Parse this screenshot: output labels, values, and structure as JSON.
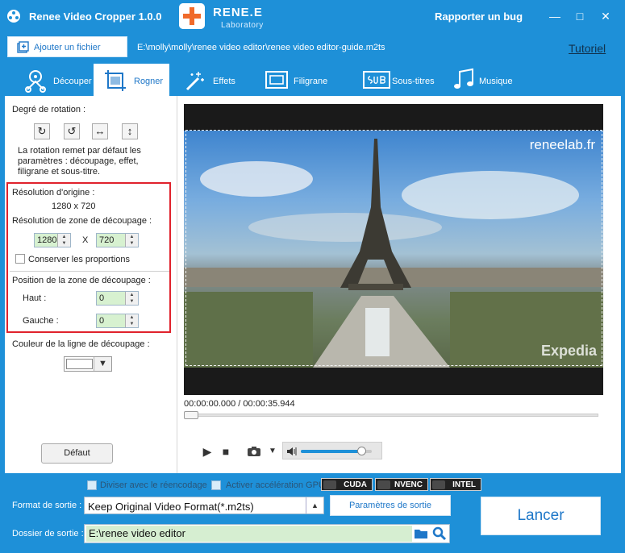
{
  "titlebar": {
    "app_title": "Renee Video Cropper 1.0.0",
    "brand_name": "RENE.E",
    "brand_sub": "Laboratory",
    "bug_link": "Rapporter un bug",
    "minimize": "—",
    "maximize": "□",
    "close": "✕"
  },
  "toolbar": {
    "add_file": "Ajouter un fichier",
    "file_path": "E:\\molly\\molly\\renee video editor\\renee video editor-guide.m2ts",
    "tutoriel": "Tutoriel"
  },
  "tabs": [
    {
      "label": "Découper",
      "icon": "scissors-reel-icon",
      "active": false
    },
    {
      "label": "Rogner",
      "icon": "crop-film-icon",
      "active": true
    },
    {
      "label": "Effets",
      "icon": "magic-wand-icon",
      "active": false
    },
    {
      "label": "Filigrane",
      "icon": "watermark-frame-icon",
      "active": false
    },
    {
      "label": "Sous-titres",
      "icon": "subtitle-sub-icon",
      "active": false
    },
    {
      "label": "Musique",
      "icon": "music-note-icon",
      "active": false
    }
  ],
  "rotation": {
    "title": "Degré de rotation :",
    "note": "La rotation remet par défaut les paramètres : découpage, effet, filigrane et sous-titre.",
    "buttons": [
      "rotate-clockwise-icon",
      "rotate-counterclockwise-icon",
      "flip-horizontal-icon",
      "flip-vertical-icon"
    ]
  },
  "resolution": {
    "origin_label": "Résolution d'origine :",
    "origin_value": "1280 x 720",
    "crop_label": "Résolution de zone de découpage :",
    "width": "1280",
    "x_sep": "X",
    "height": "720",
    "keep_ratio_label": "Conserver les proportions",
    "keep_ratio_checked": false
  },
  "position": {
    "title": "Position de la zone de découpage :",
    "top_label": "Haut :",
    "top_value": "0",
    "left_label": "Gauche :",
    "left_value": "0"
  },
  "crop_line_color": {
    "label": "Couleur de la ligne de découpage :",
    "value": "#ffffff"
  },
  "default_button": "Défaut",
  "player": {
    "watermark_top": "reneelab.fr",
    "watermark_bottom": "Expedia",
    "timecode": "00:00:00.000 / 00:00:35.944",
    "progress": 0,
    "volume": 0.85
  },
  "encoding": {
    "split_label": "Diviser avec le réencodage",
    "split_checked": false,
    "gpu_label": "Activer accélération GPU",
    "gpu_checked": false,
    "gpu_badges": [
      "CUDA",
      "NVENC",
      "INTEL"
    ]
  },
  "output": {
    "format_label": "Format de sortie :",
    "format_value": "Keep Original Video Format(*.m2ts)",
    "params_button": "Paramètres de sortie",
    "dir_label": "Dossier de sortie :",
    "dir_value": "E:\\renee video editor",
    "start_button": "Lancer"
  },
  "colors": {
    "brand_blue": "#1e90d8",
    "highlight_red": "#e0222c",
    "spin_green": "#d7f1d0"
  }
}
